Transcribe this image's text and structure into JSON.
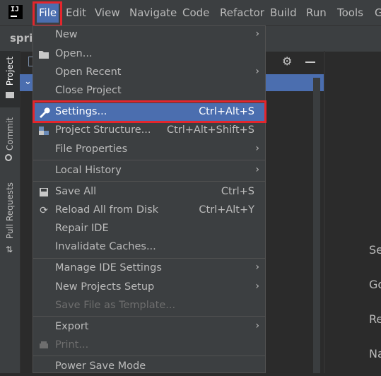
{
  "menubar": {
    "logo": "IJ",
    "items": [
      "File",
      "Edit",
      "View",
      "Navigate",
      "Code",
      "Refactor",
      "Build",
      "Run",
      "Tools",
      "G"
    ]
  },
  "project_name": "sprin",
  "toolstrip": {
    "project": "Project",
    "commit": "Commit",
    "pull_requests": "Pull Requests"
  },
  "editor_hints": [
    "Se",
    "Go",
    "Re",
    "Na"
  ],
  "file_menu": {
    "new": "New",
    "open": "Open...",
    "open_recent": "Open Recent",
    "close_project": "Close Project",
    "settings": "Settings...",
    "settings_sc": "Ctrl+Alt+S",
    "project_structure": "Project Structure...",
    "project_structure_sc": "Ctrl+Alt+Shift+S",
    "file_properties": "File Properties",
    "local_history": "Local History",
    "save_all": "Save All",
    "save_all_sc": "Ctrl+S",
    "reload": "Reload All from Disk",
    "reload_sc": "Ctrl+Alt+Y",
    "repair": "Repair IDE",
    "invalidate": "Invalidate Caches...",
    "manage_settings": "Manage IDE Settings",
    "new_projects_setup": "New Projects Setup",
    "save_template": "Save File as Template...",
    "export": "Export",
    "print": "Print...",
    "power_save": "Power Save Mode"
  },
  "colors": {
    "highlight": "#4b6eaf",
    "annotation": "#e3262d",
    "menu_bg": "#3c3f41"
  },
  "icons": [
    "folder-open-icon",
    "wrench-icon",
    "project-structure-icon",
    "save-icon",
    "reload-icon",
    "print-icon",
    "gear-icon",
    "chevron-right-icon"
  ]
}
